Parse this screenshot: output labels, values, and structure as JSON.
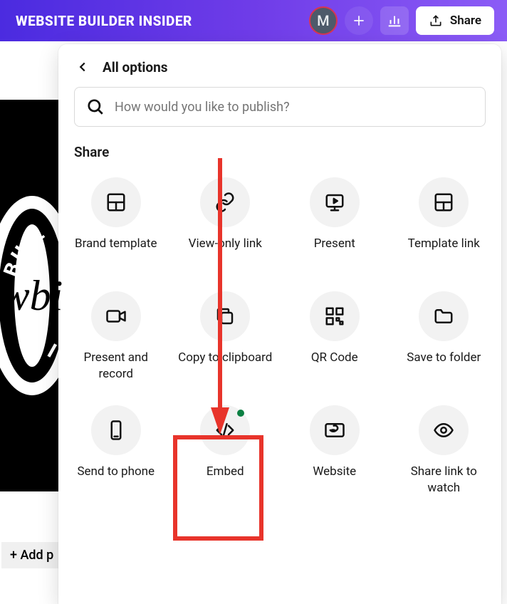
{
  "topbar": {
    "title": "WEBSITE BUILDER INSIDER",
    "avatar_initial": "M",
    "share_label": "Share"
  },
  "canvas": {
    "logo_arc_top": "BUIL",
    "logo_arc_bottom": " B S I T",
    "logo_script": "wbi",
    "add_page_label": "+ Add p"
  },
  "panel": {
    "title": "All options",
    "search_placeholder": "How would you like to publish?"
  },
  "section": {
    "title": "Share"
  },
  "options": [
    {
      "id": "brand-template",
      "label": "Brand template",
      "icon": "layout"
    },
    {
      "id": "view-only-link",
      "label": "View-only link",
      "icon": "link"
    },
    {
      "id": "present",
      "label": "Present",
      "icon": "present"
    },
    {
      "id": "template-link",
      "label": "Template link",
      "icon": "layout"
    },
    {
      "id": "present-record",
      "label": "Present and record",
      "icon": "video"
    },
    {
      "id": "copy-clipboard",
      "label": "Copy to clipboard",
      "icon": "copy"
    },
    {
      "id": "qr-code",
      "label": "QR Code",
      "icon": "qr"
    },
    {
      "id": "save-folder",
      "label": "Save to folder",
      "icon": "folder"
    },
    {
      "id": "send-phone",
      "label": "Send to phone",
      "icon": "phone"
    },
    {
      "id": "embed",
      "label": "Embed",
      "icon": "embed",
      "has_dot": true
    },
    {
      "id": "website",
      "label": "Website",
      "icon": "website"
    },
    {
      "id": "share-watch",
      "label": "Share link to watch",
      "icon": "eye"
    }
  ]
}
